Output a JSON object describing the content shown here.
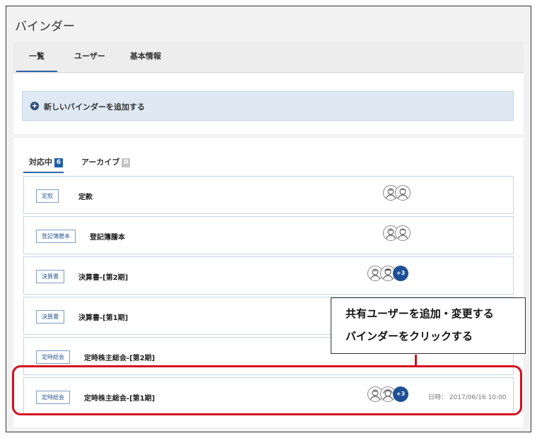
{
  "window": {
    "title": "バインダー"
  },
  "tabs": [
    {
      "label": "一覧",
      "active": true
    },
    {
      "label": "ユーザー",
      "active": false
    },
    {
      "label": "基本情報",
      "active": false
    }
  ],
  "add_binder": {
    "icon": "plus-circle-icon",
    "symbol": "+",
    "label": "新しいバインダーを追加する"
  },
  "status_tabs": [
    {
      "label": "対応中",
      "count": "6",
      "active": true
    },
    {
      "label": "アーカイブ",
      "count": "0",
      "active": false
    }
  ],
  "binders": [
    {
      "badge": "定款",
      "title": "定款",
      "avatars": 2,
      "more": "",
      "date": ""
    },
    {
      "badge": "登記簿謄本",
      "title": "登記簿謄本",
      "avatars": 2,
      "more": "",
      "date": ""
    },
    {
      "badge": "決算書",
      "title": "決算書-[第2期]",
      "avatars": 2,
      "more": "+3",
      "date": ""
    },
    {
      "badge": "決算書",
      "title": "決算書-[第1期]",
      "avatars": 0,
      "more": "",
      "date": ""
    },
    {
      "badge": "定時総会",
      "title": "定時株主総会-[第2期]",
      "avatars": 0,
      "more": "",
      "date": ""
    },
    {
      "badge": "定時総会",
      "title": "定時株主総会-[第1期]",
      "avatars": 2,
      "more": "+3",
      "date": "日時： 2017/06/16 10:00"
    }
  ],
  "callout": {
    "line1": "共有ユーザーを追加・変更する",
    "line2": "バインダーをクリックする"
  },
  "colors": {
    "accent": "#2e66a8",
    "highlight": "#d40f1f",
    "more_badge": "#1f4f96"
  }
}
